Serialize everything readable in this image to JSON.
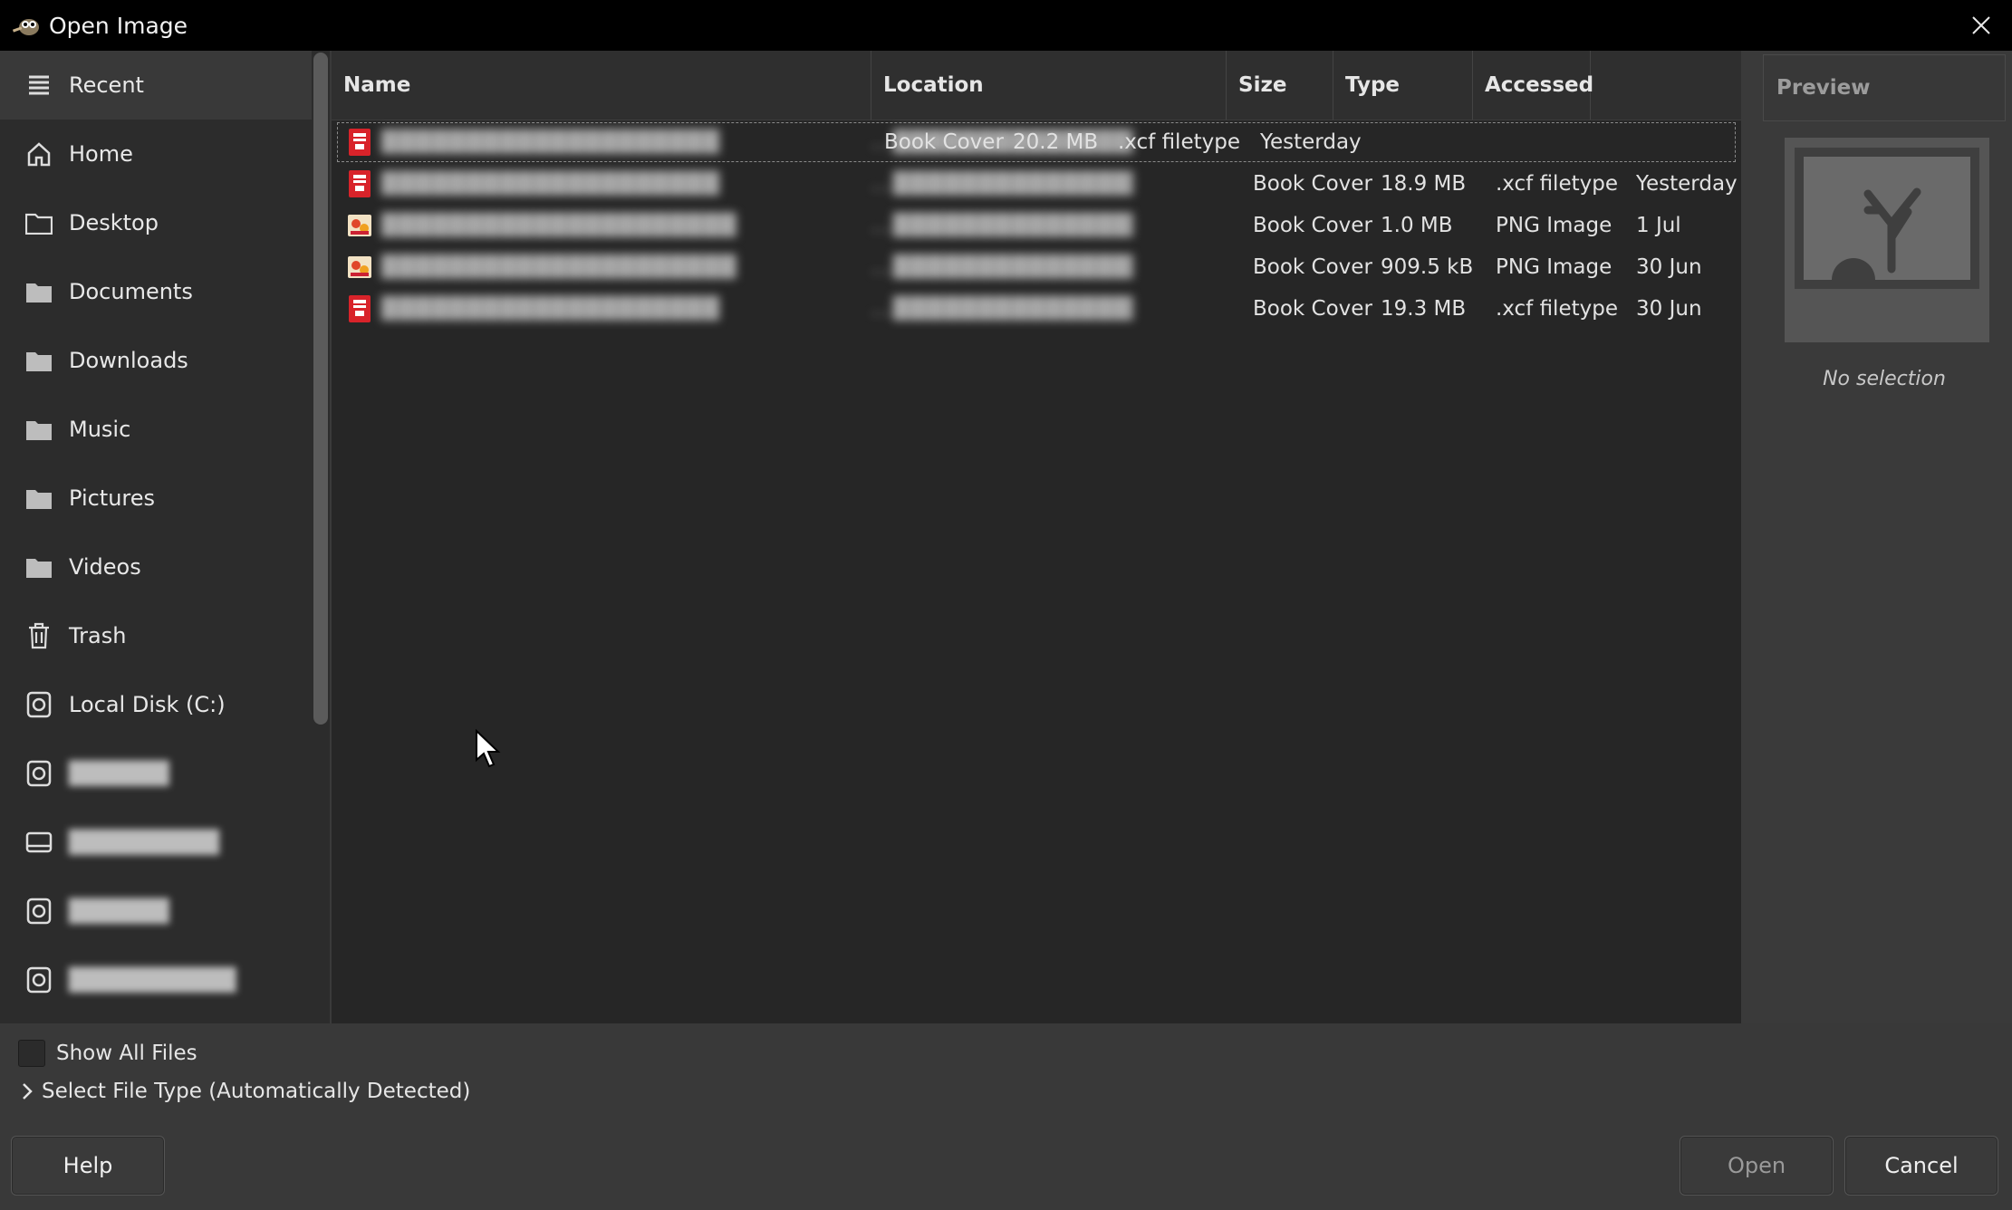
{
  "window": {
    "title": "Open Image"
  },
  "sidebar": {
    "items": [
      {
        "label": "Recent",
        "icon": "recent-icon",
        "active": true
      },
      {
        "label": "Home",
        "icon": "home-icon"
      },
      {
        "label": "Desktop",
        "icon": "folder-icon"
      },
      {
        "label": "Documents",
        "icon": "folder-icon"
      },
      {
        "label": "Downloads",
        "icon": "folder-icon"
      },
      {
        "label": "Music",
        "icon": "folder-icon"
      },
      {
        "label": "Pictures",
        "icon": "folder-icon"
      },
      {
        "label": "Videos",
        "icon": "folder-icon"
      },
      {
        "label": "Trash",
        "icon": "trash-icon"
      },
      {
        "label": "Local Disk (C:)",
        "icon": "drive-icon"
      },
      {
        "label": "██████",
        "icon": "drive-icon",
        "redacted": true
      },
      {
        "label": "█████████",
        "icon": "laptop-drive-icon",
        "redacted": true
      },
      {
        "label": "██████",
        "icon": "drive-icon",
        "redacted": true
      },
      {
        "label": "██████████",
        "icon": "drive-icon",
        "redacted": true
      }
    ]
  },
  "filelist": {
    "columns": {
      "name": "Name",
      "location": "Location",
      "size": "Size",
      "type": "Type",
      "accessed": "Accessed"
    },
    "rows": [
      {
        "name": "████████████████████",
        "location_prefix": "...████████████████████",
        "location": "Book Cover",
        "size": "20.2 MB",
        "type": ".xcf filetype",
        "accessed": "Yesterday",
        "icon": "xcf-file-icon"
      },
      {
        "name": "████████████████████",
        "location_prefix": "...████████████████████",
        "location": "Book Cover",
        "size": "18.9 MB",
        "type": ".xcf filetype",
        "accessed": "Yesterday",
        "icon": "xcf-file-icon"
      },
      {
        "name": "█████████████████████",
        "location_prefix": "...████████████████████",
        "location": "Book Cover",
        "size": "1.0 MB",
        "type": "PNG Image",
        "accessed": "1 Jul",
        "icon": "png-file-icon"
      },
      {
        "name": "█████████████████████",
        "location_prefix": "...████████████████████",
        "location": "Book Cover",
        "size": "909.5 kB",
        "type": "PNG Image",
        "accessed": "30 Jun",
        "icon": "png-file-icon"
      },
      {
        "name": "████████████████████",
        "location_prefix": "...████████████████████",
        "location": "Book Cover",
        "size": "19.3 MB",
        "type": ".xcf filetype",
        "accessed": "30 Jun",
        "icon": "xcf-file-icon"
      }
    ]
  },
  "preview": {
    "header": "Preview",
    "status": "No selection"
  },
  "options": {
    "show_all_files": "Show All Files",
    "file_type": "Select File Type (Automatically Detected)"
  },
  "buttons": {
    "help": "Help",
    "open": "Open",
    "cancel": "Cancel"
  }
}
